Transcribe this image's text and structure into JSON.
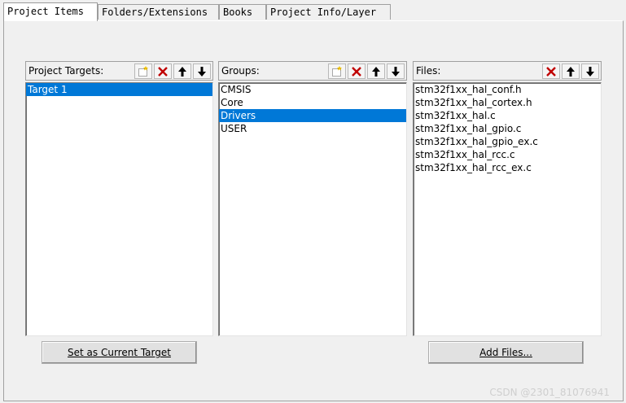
{
  "tabs": [
    {
      "label": "Project Items",
      "active": true
    },
    {
      "label": "Folders/Extensions",
      "active": false
    },
    {
      "label": "Books",
      "active": false
    },
    {
      "label": "Project Info/Layer",
      "active": false
    }
  ],
  "targets": {
    "label": "Project Targets:",
    "items": [
      "Target 1"
    ],
    "selected": "Target 1"
  },
  "groups": {
    "label": "Groups:",
    "items": [
      "CMSIS",
      "Core",
      "Drivers",
      "USER"
    ],
    "selected": "Drivers"
  },
  "files": {
    "label": "Files:",
    "items": [
      "stm32f1xx_hal_conf.h",
      "stm32f1xx_hal_cortex.h",
      "stm32f1xx_hal.c",
      "stm32f1xx_hal_gpio.c",
      "stm32f1xx_hal_gpio_ex.c",
      "stm32f1xx_hal_rcc.c",
      "stm32f1xx_hal_rcc_ex.c"
    ]
  },
  "buttons": {
    "set_current": "Set as Current Target",
    "add_files": "Add Files..."
  },
  "watermark": "CSDN @2301_81076941",
  "icons": {
    "new": "new-item-icon",
    "delete": "delete-icon",
    "up": "move-up-icon",
    "down": "move-down-icon"
  },
  "colors": {
    "selection": "#0078d7",
    "delete_red": "#c00000"
  }
}
